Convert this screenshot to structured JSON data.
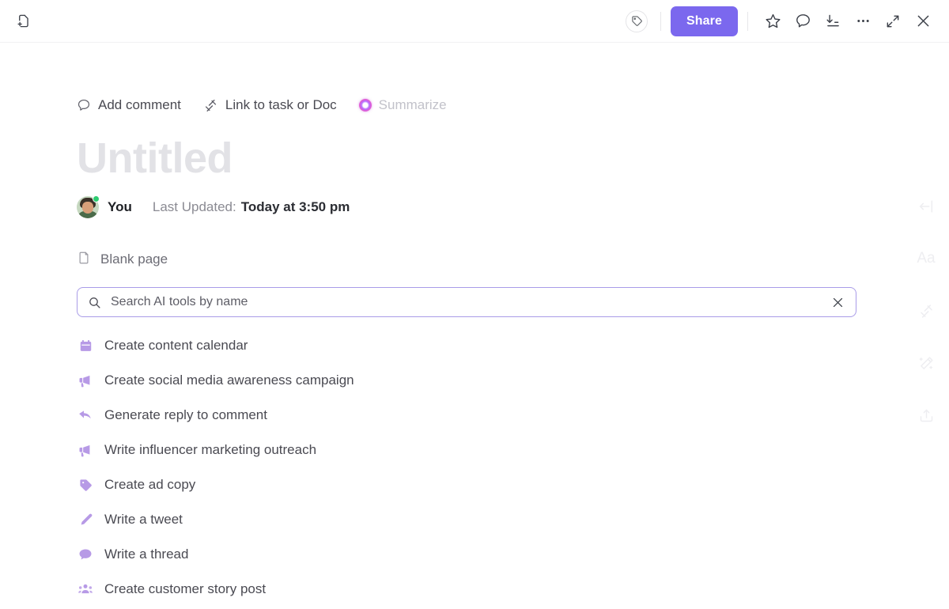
{
  "header": {
    "new_page_icon": "new-page-icon",
    "tag_icon": "tag-icon",
    "share_label": "Share",
    "favorite_icon": "star-icon",
    "comment_icon": "comment-bubble-icon",
    "download_icon": "download-icon",
    "more_icon": "ellipsis-icon",
    "expand_icon": "expand-icon",
    "close_icon": "close-icon"
  },
  "doc": {
    "actions": [
      {
        "label": "Add comment",
        "icon": "comment-bubble-icon",
        "disabled": false
      },
      {
        "label": "Link to task or Doc",
        "icon": "link-icon",
        "disabled": false
      },
      {
        "label": "Summarize",
        "icon": "ai-sparkle-icon",
        "disabled": true
      }
    ],
    "title_placeholder": "Untitled",
    "byline": {
      "author": "You",
      "updated_label": "Last Updated:",
      "updated_value": "Today at 3:50 pm",
      "presence": "online"
    },
    "blank_page": {
      "label": "Blank page",
      "icon": "page-icon"
    },
    "search": {
      "placeholder": "Search AI tools by name",
      "value": "",
      "search_icon": "search-icon",
      "clear_icon": "close-icon",
      "border_color": "#a99ce8"
    },
    "tools": [
      {
        "label": "Create content calendar",
        "icon": "calendar-icon"
      },
      {
        "label": "Create social media awareness campaign",
        "icon": "megaphone-icon"
      },
      {
        "label": "Generate reply to comment",
        "icon": "reply-arrow-icon"
      },
      {
        "label": "Write influencer marketing outreach",
        "icon": "megaphone-icon"
      },
      {
        "label": "Create ad copy",
        "icon": "tag-icon"
      },
      {
        "label": "Write a tweet",
        "icon": "pen-icon"
      },
      {
        "label": "Write a thread",
        "icon": "speech-bubble-icon"
      },
      {
        "label": "Create customer story post",
        "icon": "people-group-icon"
      }
    ]
  },
  "rail": {
    "items": [
      {
        "name": "collapse-panel-icon",
        "label": ""
      },
      {
        "name": "font-size-icon",
        "label": "Aa"
      },
      {
        "name": "relationship-icon",
        "label": ""
      },
      {
        "name": "magic-wand-icon",
        "label": ""
      },
      {
        "name": "upload-icon",
        "label": ""
      }
    ]
  },
  "theme": {
    "accent": "#7b68ee",
    "tool_icon_color": "#b79ae6",
    "title_placeholder_color": "#e2e2e6"
  }
}
